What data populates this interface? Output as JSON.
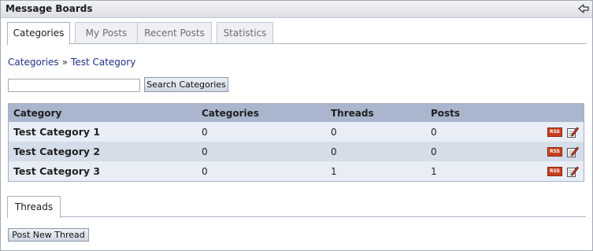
{
  "portlet": {
    "title": "Message Boards",
    "back_icon": "arrow-left-icon"
  },
  "tabs": [
    "Categories",
    "My Posts",
    "Recent Posts",
    "Statistics"
  ],
  "active_tab": "Categories",
  "breadcrumb": {
    "root": "Categories",
    "separator": "»",
    "current": "Test Category"
  },
  "search": {
    "value": "",
    "button_label": "Search Categories"
  },
  "table": {
    "headers": [
      "Category",
      "Categories",
      "Threads",
      "Posts"
    ],
    "rows": [
      {
        "name": "Test Category 1",
        "categories": "0",
        "threads": "0",
        "posts": "0"
      },
      {
        "name": "Test Category 2",
        "categories": "0",
        "threads": "0",
        "posts": "0"
      },
      {
        "name": "Test Category 3",
        "categories": "0",
        "threads": "1",
        "posts": "1"
      }
    ],
    "rss_label": "RSS",
    "row_icons": [
      "rss-icon",
      "edit-icon"
    ]
  },
  "threads": {
    "tab_label": "Threads",
    "post_button_label": "Post New Thread"
  },
  "colors": {
    "header_bg": "#a9b6cd",
    "row_odd": "#e9eef6",
    "row_even": "#d5dde9",
    "link": "#1e2f86",
    "rss": "#c73e1d"
  }
}
